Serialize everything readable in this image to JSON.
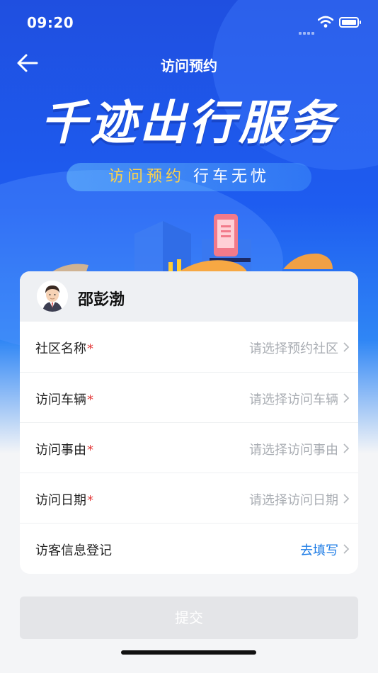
{
  "status_bar": {
    "time": "09:20",
    "icons": [
      "signal-icon",
      "wifi-icon",
      "battery-icon"
    ]
  },
  "nav": {
    "title": "访问预约",
    "back_icon": "arrow-left-icon"
  },
  "banner": {
    "title": "千迹出行服务",
    "subtitle_a": "访问预约",
    "subtitle_b": "行车无忧"
  },
  "user": {
    "name": "邵彭渤",
    "avatar_icon": "user-avatar-icon"
  },
  "form": {
    "rows": [
      {
        "label": "社区名称",
        "required": "*",
        "value": "请选择预约社区"
      },
      {
        "label": "访问车辆",
        "required": "*",
        "value": "请选择访问车辆"
      },
      {
        "label": "访问事由",
        "required": "*",
        "value": "请选择访问事由"
      },
      {
        "label": "访问日期",
        "required": "*",
        "value": "请选择访问日期"
      },
      {
        "label": "访客信息登记",
        "required": "",
        "value": "去填写"
      }
    ]
  },
  "submit": {
    "label": "提交"
  },
  "colors": {
    "primary": "#1e5cf0",
    "required": "#e33b3b",
    "link": "#1f7de6",
    "placeholder": "#a9adb3",
    "accent_yellow": "#ffd34a"
  }
}
